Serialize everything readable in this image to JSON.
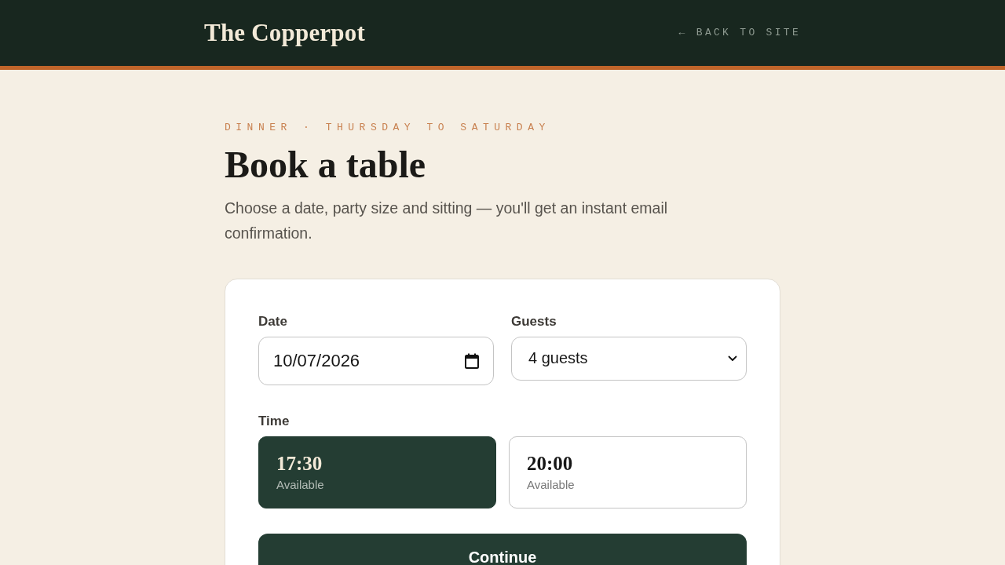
{
  "header": {
    "logo": "The Copperpot",
    "back_link": "← BACK TO SITE"
  },
  "eyebrow": "DINNER · THURSDAY TO SATURDAY",
  "title": "Book a table",
  "intro": "Choose a date, party size and sitting — you'll get an instant email confirmation.",
  "form": {
    "date": {
      "label": "Date",
      "value": "10/07/2026"
    },
    "guests": {
      "label": "Guests",
      "value": "4 guests"
    },
    "time": {
      "label": "Time",
      "slots": [
        {
          "time": "17:30",
          "status": "Available",
          "selected": true
        },
        {
          "time": "20:00",
          "status": "Available",
          "selected": false
        }
      ]
    },
    "submit": "Continue"
  }
}
